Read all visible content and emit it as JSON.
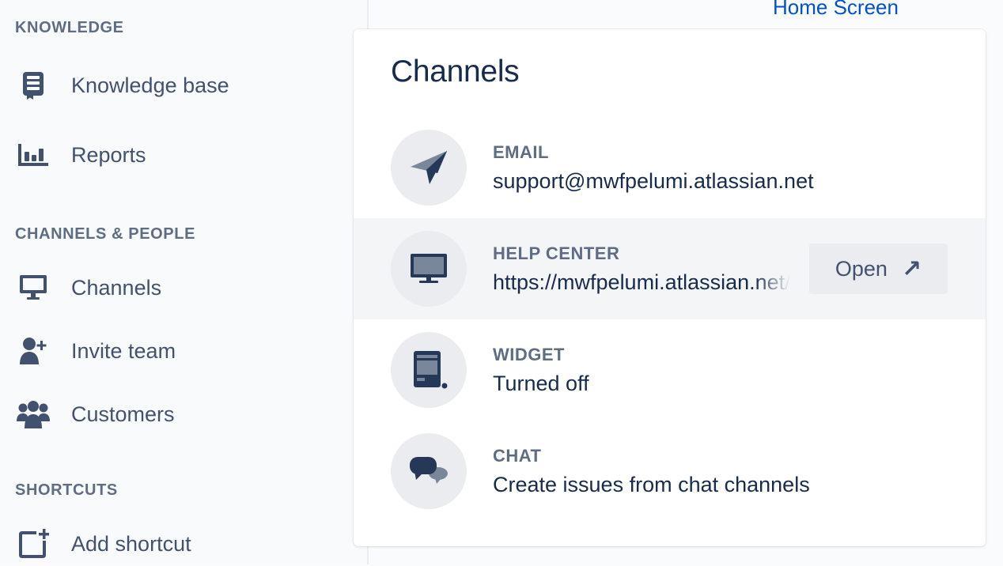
{
  "sidebar": {
    "sections": [
      {
        "heading": "KNOWLEDGE",
        "items": [
          {
            "label": "Knowledge base",
            "icon": "book-icon"
          },
          {
            "label": "Reports",
            "icon": "bar-chart-icon"
          }
        ]
      },
      {
        "heading": "CHANNELS & PEOPLE",
        "items": [
          {
            "label": "Channels",
            "icon": "monitor-icon"
          },
          {
            "label": "Invite team",
            "icon": "add-person-icon"
          },
          {
            "label": "Customers",
            "icon": "people-group-icon"
          }
        ]
      },
      {
        "heading": "SHORTCUTS",
        "items": [
          {
            "label": "Add shortcut",
            "icon": "add-shortcut-icon"
          }
        ]
      }
    ]
  },
  "header": {
    "home_link": "Home Screen"
  },
  "channels": {
    "title": "Channels",
    "rows": [
      {
        "label": "EMAIL",
        "value": "support@mwfpelumi.atlassian.net",
        "icon": "paper-plane-icon"
      },
      {
        "label": "HELP CENTER",
        "value": "https://mwfpelumi.atlassian.net/servicedesk/customer/portals",
        "icon": "monitor-icon",
        "button": "Open",
        "button_icon": "arrow-up-right-icon"
      },
      {
        "label": "WIDGET",
        "value": "Turned off",
        "icon": "widget-icon"
      },
      {
        "label": "CHAT",
        "value": "Create issues from chat channels",
        "icon": "chat-bubbles-icon"
      }
    ]
  },
  "colors": {
    "heading": "#172b4d",
    "text": "#42526e",
    "muted": "#5e6c84",
    "link": "#0052cc",
    "icon_fill": "#253858",
    "circle_bg": "#ebecf0",
    "row_highlight": "#f4f5f7"
  }
}
